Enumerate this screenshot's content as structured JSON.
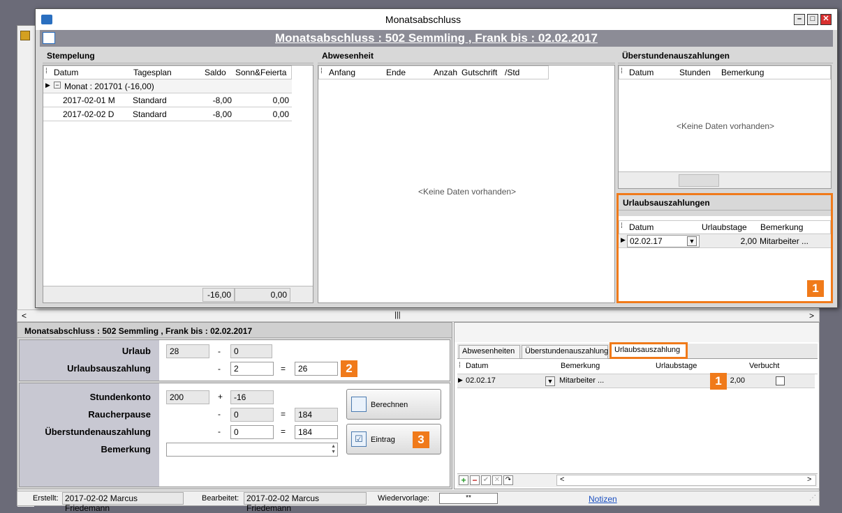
{
  "dialog": {
    "title": "Monatsabschluss",
    "banner": "Monatsabschluss  : 502  Semmling , Frank   bis : 02.02.2017"
  },
  "stempelung": {
    "title": "Stempelung",
    "columns": [
      "Datum",
      "Tagesplan",
      "Saldo",
      "Sonn&Feierta"
    ],
    "group": "Monat : 201701 (-16,00)",
    "rows": [
      {
        "datum": "2017-02-01  M",
        "plan": "Standard",
        "saldo": "-8,00",
        "sonn": "0,00"
      },
      {
        "datum": "2017-02-02  D",
        "plan": "Standard",
        "saldo": "-8,00",
        "sonn": "0,00"
      }
    ],
    "total_saldo": "-16,00",
    "total_sonn": "0,00"
  },
  "abwesenheit": {
    "title": "Abwesenheit",
    "columns": [
      "Anfang",
      "Ende",
      "Anzah",
      "Gutschrift",
      "/Std"
    ],
    "empty": "<Keine Daten vorhanden>"
  },
  "ueberstunden": {
    "title": "Überstundenauszahlungen",
    "columns": [
      "Datum",
      "Stunden",
      "Bemerkung"
    ],
    "empty": "<Keine Daten vorhanden>"
  },
  "urlaubsauszahlungen": {
    "title": "Urlaubsauszahlungen",
    "columns": [
      "Datum",
      "Urlaubstage",
      "Bemerkung"
    ],
    "row": {
      "datum": "02.02.17",
      "tage": "2,00",
      "bemerkung": "Mitarbeiter ..."
    },
    "badge": "1"
  },
  "form": {
    "header": "Monatsabschluss  : 502  Semmling , Frank   bis : 02.02.2017",
    "urlaub_label": "Urlaub",
    "urlaub_value": "28",
    "urlaub_minus": "0",
    "auszahlung_label": "Urlaubsauszahlung",
    "auszahlung_value": "2",
    "auszahlung_result": "26",
    "badge2": "2",
    "stundenkonto_label": "Stundenkonto",
    "stundenkonto_value": "200",
    "stundenkonto_plus": "-16",
    "raucher_label": "Raucherpause",
    "raucher_value": "0",
    "raucher_result": "184",
    "ueber_label": "Überstundenauszahlung",
    "ueber_value": "0",
    "ueber_result": "184",
    "bemerkung_label": "Bemerkung",
    "minus": "-",
    "plus": "+",
    "equals": "=",
    "berechnen": "Berechnen",
    "eintrag": "Eintrag",
    "badge3": "3"
  },
  "tabs": {
    "items": [
      "Abwesenheiten",
      "Überstundenauszahlung",
      "Urlaubsauszahlung"
    ],
    "columns": [
      "Datum",
      "Bemerkung",
      "Urlaubstage",
      "Verbucht"
    ],
    "row": {
      "datum": "02.02.17",
      "bemerkung": "Mitarbeiter ...",
      "tage": "2,00"
    },
    "badge": "1"
  },
  "status": {
    "erstellt_label": "Erstellt:",
    "erstellt_value": "2017-02-02  Marcus Friedemann",
    "bearbeitet_label": "Bearbeitet:",
    "bearbeitet_value": "2017-02-02  Marcus Friedemann",
    "wiedervorlage_label": "Wiedervorlage:",
    "wiedervorlage_value": "**",
    "notizen": "Notizen"
  },
  "colors": {
    "accent": "#f07a1a",
    "banner": "#8c8c96"
  }
}
